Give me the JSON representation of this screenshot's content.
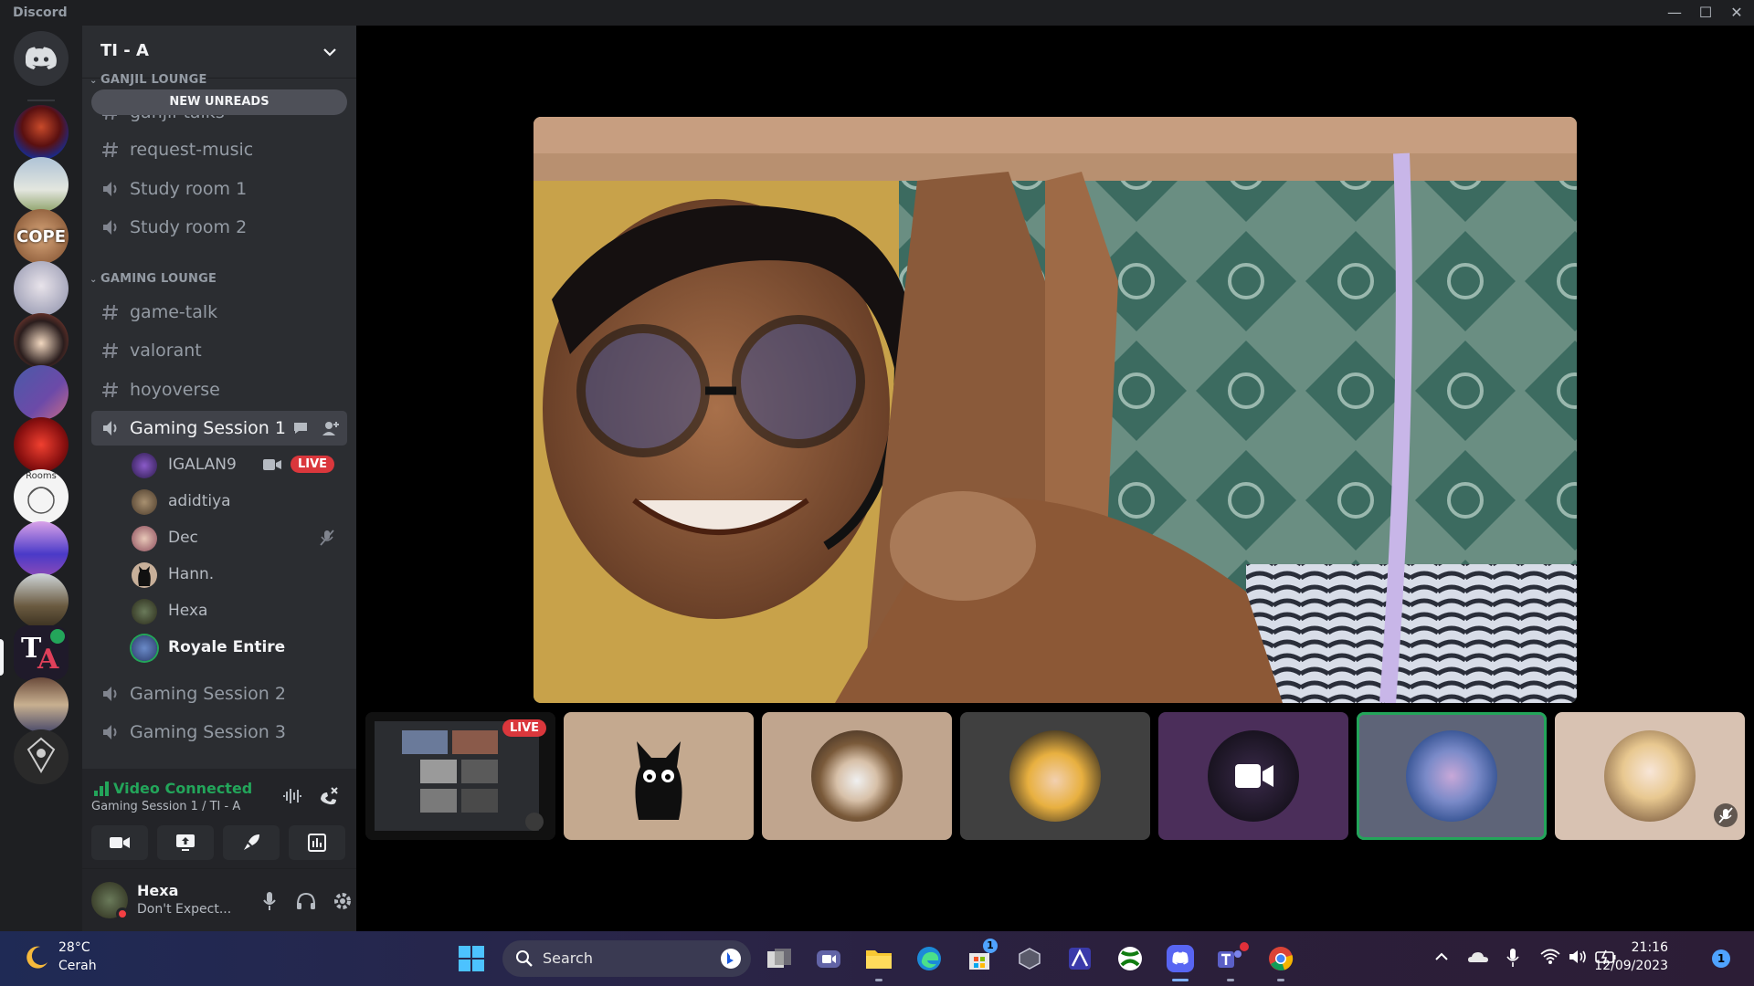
{
  "window": {
    "title": "Discord"
  },
  "server": {
    "name": "TI - A"
  },
  "sidebar": {
    "new_unreads": "NEW UNREADS",
    "categories": [
      {
        "name": "GANJIL LOUNGE"
      },
      {
        "name": "GAMING LOUNGE"
      }
    ],
    "channels": [
      {
        "name": "ganjil-talks",
        "type": "text"
      },
      {
        "name": "request-music",
        "type": "text"
      },
      {
        "name": "Study room 1",
        "type": "voice"
      },
      {
        "name": "Study room 2",
        "type": "voice"
      },
      {
        "name": "game-talk",
        "type": "text"
      },
      {
        "name": "valorant",
        "type": "text"
      },
      {
        "name": "hoyoverse",
        "type": "text"
      },
      {
        "name": "Gaming Session 1",
        "type": "voice",
        "active": true
      },
      {
        "name": "Gaming Session 2",
        "type": "voice"
      },
      {
        "name": "Gaming Session 3",
        "type": "voice"
      }
    ],
    "voice_users": [
      {
        "name": "IGALAN9",
        "live": true,
        "video": true
      },
      {
        "name": "adidtiya"
      },
      {
        "name": "Dec",
        "muted": true
      },
      {
        "name": "Hann."
      },
      {
        "name": "Hexa"
      },
      {
        "name": "Royale Entire",
        "speaking": true
      }
    ],
    "live_label": "LIVE"
  },
  "voice_panel": {
    "status": "Video Connected",
    "location": "Gaming Session 1 / TI - A"
  },
  "user_panel": {
    "username": "Hexa",
    "status": "Don't Expect..."
  },
  "rail": {
    "rooms_label": "Rooms",
    "cope_label": "COPE"
  },
  "stage": {
    "live_label": "LIVE",
    "tiles": [
      "stream-preview",
      "cat-avatar",
      "masked-man-avatar",
      "anime-girl-avatar",
      "video-icon-avatar",
      "blue-hair-avatar",
      "blonde-anime-avatar"
    ]
  },
  "taskbar": {
    "weather_temp": "28°C",
    "weather_cond": "Cerah",
    "search": "Search",
    "store_badge": "1",
    "time": "21:16",
    "date": "12/09/2023",
    "notifications": "1"
  },
  "colors": {
    "accent_green": "#23a55a",
    "live_red": "#da373c",
    "sidebar_bg": "#2b2d31",
    "rail_bg": "#1e1f22"
  }
}
